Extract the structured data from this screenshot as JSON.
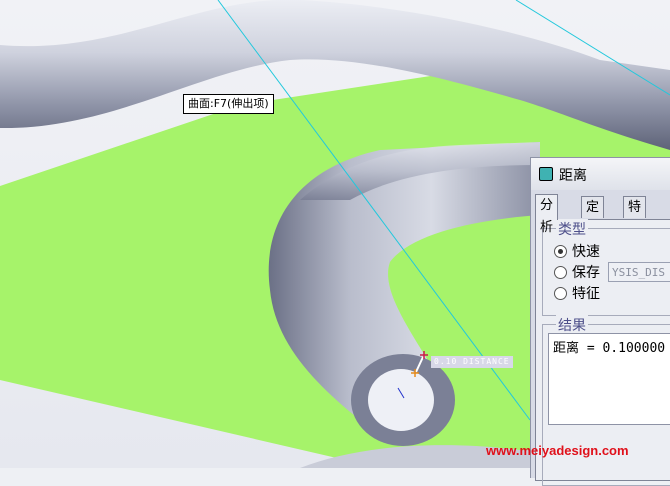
{
  "viewport": {
    "tooltip": "曲面:F7(伸出项)",
    "measure_label": "0.10 DISTANCE",
    "colors": {
      "plane": "#a6f36a",
      "tube": "#c3c7d6",
      "axis_line": "#22c8dc"
    }
  },
  "dialog": {
    "title": "距离",
    "icon": "dialog-icon",
    "tabs": [
      {
        "label": "分析",
        "active": true
      },
      {
        "label": "定义",
        "active": false
      },
      {
        "label": "特征",
        "active": false
      }
    ],
    "type_group": {
      "title": "类型",
      "options": [
        {
          "label": "快速",
          "checked": true
        },
        {
          "label": "保存",
          "checked": false
        },
        {
          "label": "特征",
          "checked": false
        }
      ],
      "name_field_value": "YSIS_DIS"
    },
    "results_group": {
      "title": "结果",
      "lines": [
        "距离 = 0.100000"
      ]
    }
  },
  "watermark": "www.meiyadesign.com"
}
